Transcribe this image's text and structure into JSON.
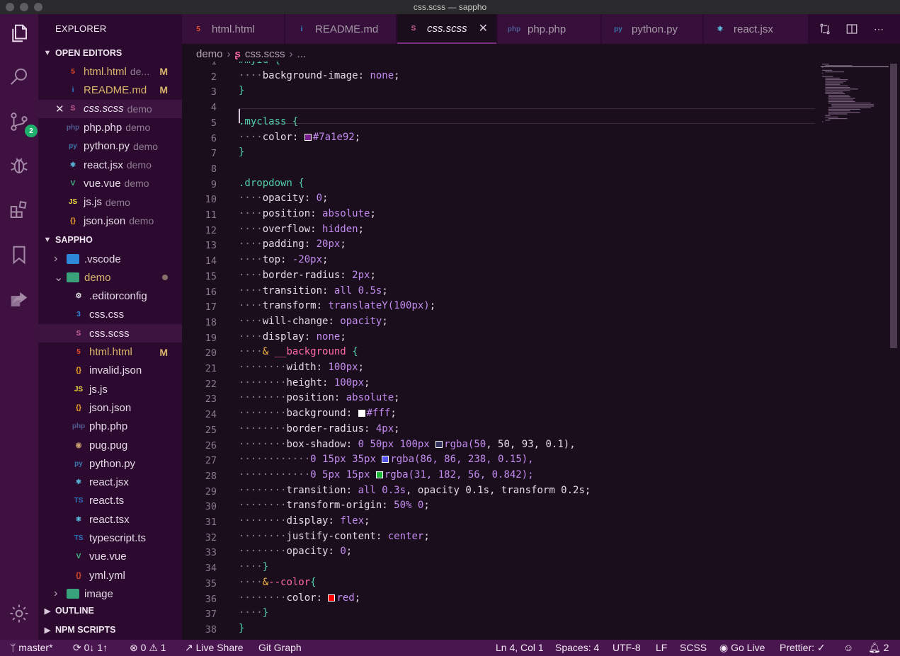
{
  "window": {
    "title": "css.scss — sappho"
  },
  "sidebar": {
    "title": "EXPLORER",
    "open_editors_label": "OPEN EDITORS",
    "open_editors": [
      {
        "name": "html.html",
        "desc": "de...",
        "badge": "M",
        "icon": "html-icon",
        "color": "#e44d26",
        "glyph": "5"
      },
      {
        "name": "README.md",
        "desc": "",
        "badge": "M",
        "icon": "info-icon",
        "color": "#2e8ad8",
        "glyph": "i"
      },
      {
        "name": "css.scss",
        "desc": "demo",
        "badge": "",
        "icon": "sass-icon",
        "color": "#cd6799",
        "glyph": "S"
      },
      {
        "name": "php.php",
        "desc": "demo",
        "badge": "",
        "icon": "php-icon",
        "color": "#4f5b93",
        "glyph": "php"
      },
      {
        "name": "python.py",
        "desc": "demo",
        "badge": "",
        "icon": "python-icon",
        "color": "#3776ab",
        "glyph": "py"
      },
      {
        "name": "react.jsx",
        "desc": "demo",
        "badge": "",
        "icon": "react-icon",
        "color": "#61dafb",
        "glyph": "⚛"
      },
      {
        "name": "vue.vue",
        "desc": "demo",
        "badge": "",
        "icon": "vue-icon",
        "color": "#41b883",
        "glyph": "V"
      },
      {
        "name": "js.js",
        "desc": "demo",
        "badge": "",
        "icon": "js-icon",
        "color": "#f1dd3f",
        "glyph": "JS"
      },
      {
        "name": "json.json",
        "desc": "demo",
        "badge": "",
        "icon": "json-icon",
        "color": "#f5a623",
        "glyph": "{}"
      }
    ],
    "project_label": "SAPPHO",
    "project_tree": [
      {
        "name": ".vscode",
        "kind": "folder",
        "icon": "vscode-folder-icon",
        "color": "#2e8ad8",
        "glyph": "▶"
      },
      {
        "name": "demo",
        "kind": "folder-open",
        "icon": "folder-open-icon",
        "color": "#38a37a",
        "glyph": "▼"
      },
      {
        "name": ".editorconfig",
        "kind": "file",
        "icon": "editorconfig-icon",
        "color": "#e8e8e8",
        "glyph": "⚙"
      },
      {
        "name": "css.css",
        "kind": "file",
        "icon": "css-icon",
        "color": "#2e8ad8",
        "glyph": "3"
      },
      {
        "name": "css.scss",
        "kind": "file",
        "icon": "sass-icon",
        "color": "#cd6799",
        "glyph": "S"
      },
      {
        "name": "html.html",
        "kind": "file",
        "badge": "M",
        "icon": "html-icon",
        "color": "#e44d26",
        "glyph": "5"
      },
      {
        "name": "invalid.json",
        "kind": "file",
        "icon": "json-icon",
        "color": "#f5a623",
        "glyph": "{}"
      },
      {
        "name": "js.js",
        "kind": "file",
        "icon": "js-icon",
        "color": "#f1dd3f",
        "glyph": "JS"
      },
      {
        "name": "json.json",
        "kind": "file",
        "icon": "json-icon",
        "color": "#f5a623",
        "glyph": "{}"
      },
      {
        "name": "php.php",
        "kind": "file",
        "icon": "php-icon",
        "color": "#4f5b93",
        "glyph": "php"
      },
      {
        "name": "pug.pug",
        "kind": "file",
        "icon": "pug-icon",
        "color": "#c59a6d",
        "glyph": "◉"
      },
      {
        "name": "python.py",
        "kind": "file",
        "icon": "python-icon",
        "color": "#3776ab",
        "glyph": "py"
      },
      {
        "name": "react.jsx",
        "kind": "file",
        "icon": "react-icon",
        "color": "#61dafb",
        "glyph": "⚛"
      },
      {
        "name": "react.ts",
        "kind": "file",
        "icon": "ts-icon",
        "color": "#2f74c0",
        "glyph": "TS"
      },
      {
        "name": "react.tsx",
        "kind": "file",
        "icon": "react-icon",
        "color": "#61dafb",
        "glyph": "⚛"
      },
      {
        "name": "typescript.ts",
        "kind": "file",
        "icon": "ts-icon",
        "color": "#2f74c0",
        "glyph": "TS"
      },
      {
        "name": "vue.vue",
        "kind": "file",
        "icon": "vue-icon",
        "color": "#41b883",
        "glyph": "V"
      },
      {
        "name": "yml.yml",
        "kind": "file",
        "icon": "yaml-icon",
        "color": "#e44d26",
        "glyph": "{}"
      },
      {
        "name": "image",
        "kind": "folder",
        "icon": "image-folder-icon",
        "color": "#38a37a",
        "glyph": "▶"
      }
    ],
    "outline_label": "OUTLINE",
    "npm_label": "NPM SCRIPTS"
  },
  "tabs": [
    {
      "label": "html.html",
      "icon": "html-icon",
      "color": "#e44d26",
      "glyph": "5",
      "active": false
    },
    {
      "label": "README.md",
      "icon": "info-icon",
      "color": "#2e8ad8",
      "glyph": "i",
      "active": false
    },
    {
      "label": "css.scss",
      "icon": "sass-icon",
      "color": "#cd6799",
      "glyph": "S",
      "active": true
    },
    {
      "label": "php.php",
      "icon": "php-icon",
      "color": "#4f5b93",
      "glyph": "php",
      "active": false
    },
    {
      "label": "python.py",
      "icon": "python-icon",
      "color": "#3776ab",
      "glyph": "py",
      "active": false
    },
    {
      "label": "react.jsx",
      "icon": "react-icon",
      "color": "#61dafb",
      "glyph": "⚛",
      "active": false
    }
  ],
  "breadcrumb": {
    "folder": "demo",
    "file": "css.scss",
    "more": "..."
  },
  "editor": {
    "lines": [
      "#myId {",
      "    background-image: none;",
      "}",
      "",
      ".myclass {",
      "    color: #7a1e92;",
      "}",
      "",
      ".dropdown {",
      "    opacity: 0;",
      "    position: absolute;",
      "    overflow: hidden;",
      "    padding: 20px;",
      "    top: -20px;",
      "    border-radius: 2px;",
      "    transition: all 0.5s;",
      "    transform: translateY(100px);",
      "    will-change: opacity;",
      "    display: none;",
      "    & __background {",
      "        width: 100px;",
      "        height: 100px;",
      "        position: absolute;",
      "        background: #fff;",
      "        border-radius: 4px;",
      "        box-shadow: 0 50px 100px rgba(50, 50, 93, 0.1),",
      "            0 15px 35px rgba(86, 86, 238, 0.15),",
      "            0 5px 15px rgba(31, 182, 56, 0.842);",
      "        transition: all 0.3s, opacity 0.1s, transform 0.2s;",
      "        transform-origin: 50% 0;",
      "        display: flex;",
      "        justify-content: center;",
      "        opacity: 0;",
      "    }",
      "    &--color{",
      "        color: red;",
      "    }",
      "}"
    ],
    "swatches": {
      "6": "#7a1e92",
      "24": "#ffffff",
      "26": "#32325d",
      "27": "#5656ee",
      "28": "#1fb638",
      "36": "#ff0000"
    }
  },
  "statusbar": {
    "branch": "master*",
    "sync": "0↓ 1↑",
    "errors": "0",
    "warnings": "1",
    "live_share": "Live Share",
    "git_graph": "Git Graph",
    "position": "Ln 4, Col 1",
    "spaces": "Spaces: 4",
    "encoding": "UTF-8",
    "eol": "LF",
    "language": "SCSS",
    "go_live": "Go Live",
    "prettier": "Prettier: ✓",
    "notifications": "2"
  },
  "activity": {
    "scm_badge": "2"
  }
}
